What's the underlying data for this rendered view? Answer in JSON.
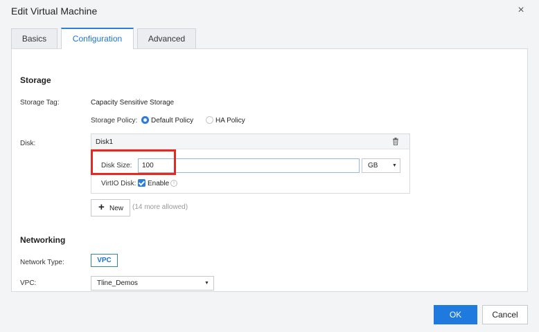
{
  "dialog": {
    "title": "Edit Virtual Machine",
    "close_glyph": "×"
  },
  "tabs": [
    {
      "label": "Basics",
      "active": false
    },
    {
      "label": "Configuration",
      "active": true
    },
    {
      "label": "Advanced",
      "active": false
    }
  ],
  "storage": {
    "section_title": "Storage",
    "tag_label": "Storage Tag:",
    "tag_value": "Capacity Sensitive Storage",
    "policy_label": "Storage Policy:",
    "policy_options": [
      {
        "label": "Default Policy",
        "selected": true
      },
      {
        "label": "HA Policy",
        "selected": false
      }
    ],
    "disk_label": "Disk:",
    "disk": {
      "name": "Disk1",
      "size_label": "Disk Size:",
      "size_value": "100",
      "unit": "GB",
      "virtio_label": "VirtIO Disk:",
      "virtio_option": "Enable",
      "virtio_enabled": true
    },
    "new_button": "New",
    "more_allowed": "(14 more allowed)"
  },
  "networking": {
    "section_title": "Networking",
    "network_type_label": "Network Type:",
    "network_type_value": "VPC",
    "vpc_label": "VPC:",
    "vpc_value": "Tline_Demos"
  },
  "footer": {
    "ok_label": "OK",
    "cancel_label": "Cancel"
  },
  "colors": {
    "accent": "#1f7ae0",
    "highlight": "#e8281e"
  }
}
